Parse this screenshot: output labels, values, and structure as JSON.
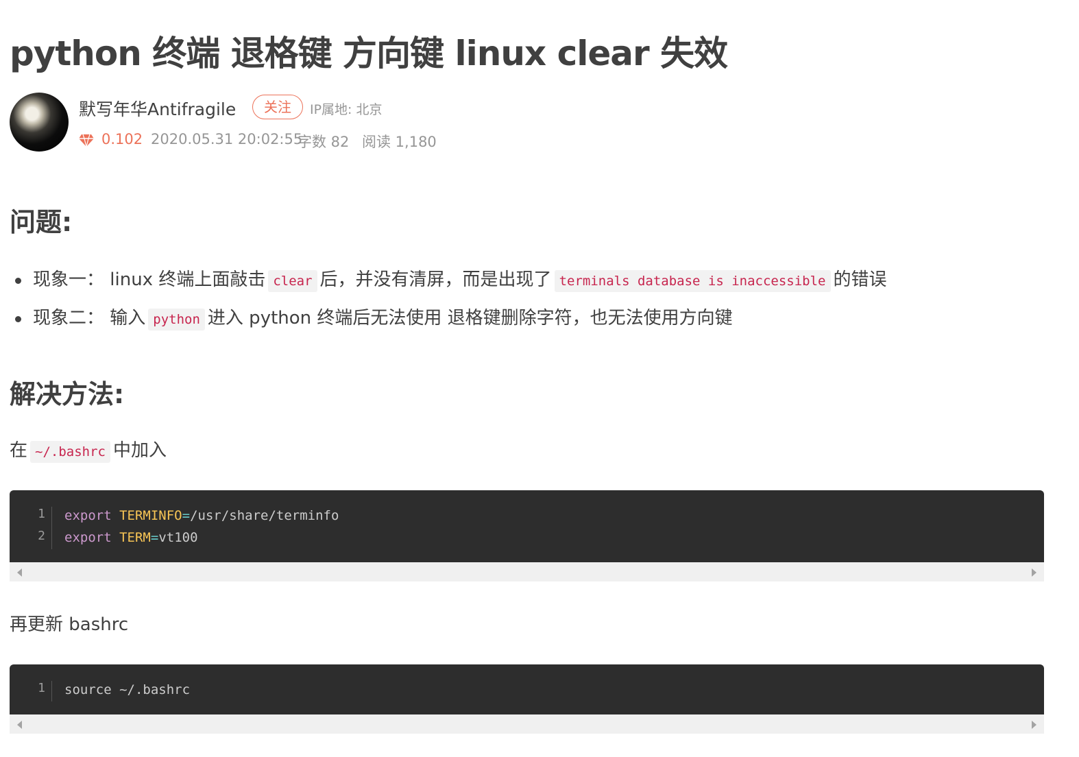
{
  "article": {
    "title": "python 终端 退格键 方向键 linux clear 失效"
  },
  "author": {
    "name": "默写年华Antifragile",
    "follow_label": "关注",
    "ip_location": "IP属地: 北京",
    "diamond_icon": "diamond-icon",
    "score": "0.102",
    "date": "2020.05.31 20:02:55",
    "word_count": "字数 82",
    "read_count": "阅读 1,180"
  },
  "problem": {
    "heading": "问题:",
    "items": [
      {
        "label": "现象一：",
        "text_before": " linux 终端上面敲击",
        "code1": "clear",
        "text_middle": "后，并没有清屏，而是出现了",
        "code2": "terminals database is inaccessible",
        "text_after": "的错误"
      },
      {
        "label": "现象二：",
        "text_before": " 输入",
        "code1": "python",
        "text_after": "进入 python 终端后无法使用 退格键删除字符，也无法使用方向键"
      }
    ]
  },
  "solution": {
    "heading": "解决方法:",
    "add_prefix": "在",
    "add_code": "~/.bashrc",
    "add_suffix": "中加入",
    "code_block_1": {
      "lines": [
        {
          "number": "1",
          "keyword": "export",
          "var": "TERMINFO",
          "op": "=",
          "value": "/usr/share/terminfo"
        },
        {
          "number": "2",
          "keyword": "export",
          "var": "TERM",
          "op": "=",
          "value": "vt100"
        }
      ]
    },
    "update_text": "再更新 bashrc",
    "code_block_2": {
      "lines": [
        {
          "number": "1",
          "text": "source ~/.bashrc"
        }
      ]
    }
  },
  "colors": {
    "accent": "#ec7259",
    "text": "#404040",
    "muted": "#969696",
    "code_bg": "#2d2d2d",
    "inline_code": "#c7254e"
  }
}
